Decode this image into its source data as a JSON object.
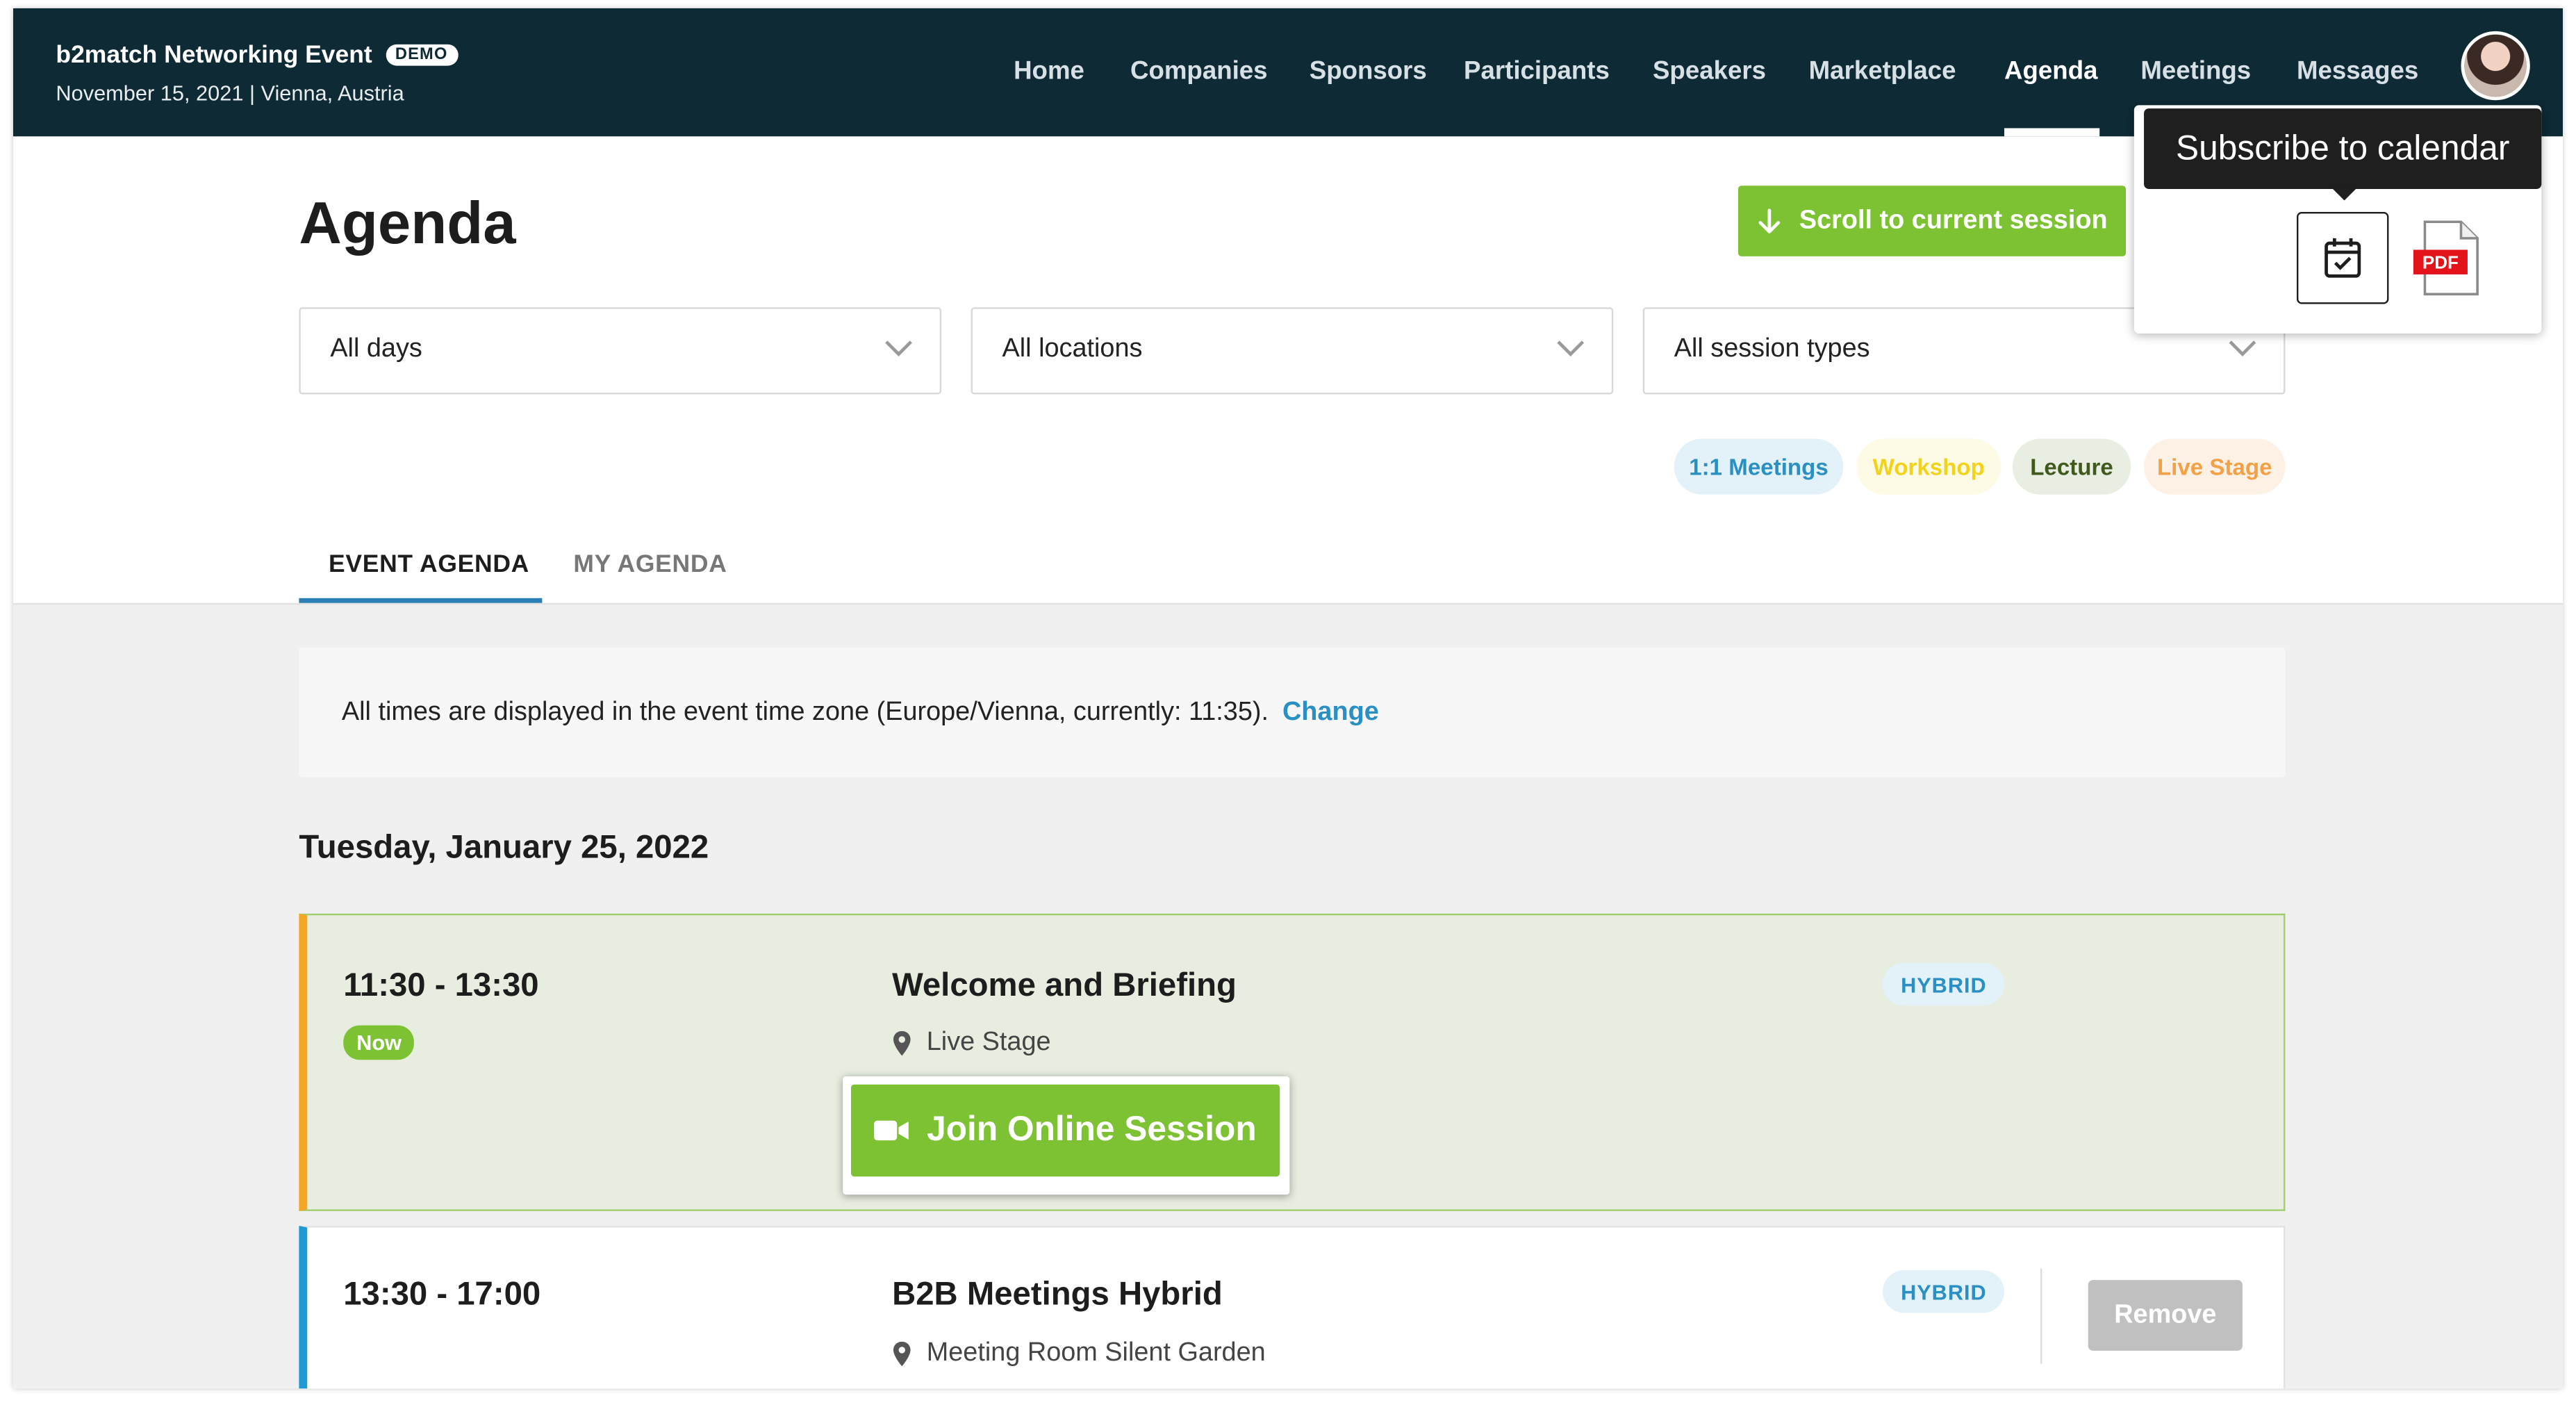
{
  "header": {
    "event_name": "b2match Networking Event",
    "demo_badge": "DEMO",
    "event_subtitle": "November 15, 2021 | Vienna, Austria",
    "nav": [
      "Home",
      "Companies",
      "Sponsors",
      "Participants",
      "Speakers",
      "Marketplace",
      "Agenda",
      "Meetings",
      "Messages"
    ],
    "active_nav": "Agenda"
  },
  "page": {
    "title": "Agenda",
    "scroll_button": "Scroll to current session"
  },
  "filters": {
    "days": "All days",
    "locations": "All locations",
    "session_types": "All session types"
  },
  "legend_tags": [
    {
      "label": "1:1 Meetings",
      "color": "#2a8fc3",
      "bg": "#e3f1f9"
    },
    {
      "label": "Workshop",
      "color": "#f2d21b",
      "bg": "#fdfbe6"
    },
    {
      "label": "Lecture",
      "color": "#3f5a1c",
      "bg": "#e9eee3"
    },
    {
      "label": "Live Stage",
      "color": "#f3a046",
      "bg": "#fdf1e6"
    }
  ],
  "tabs": {
    "event_agenda": "EVENT AGENDA",
    "my_agenda": "MY AGENDA"
  },
  "timezone": {
    "text": "All times are displayed in the event time zone (Europe/Vienna, currently: 11:35).",
    "change_link": "Change"
  },
  "agenda": {
    "date": "Tuesday, January 25, 2022",
    "sessions": [
      {
        "time": "11:30 - 13:30",
        "badge": "Now",
        "title": "Welcome and Briefing",
        "location": "Live Stage",
        "format": "HYBRID",
        "join_button": "Join Online Session",
        "accent": "#f5a623"
      },
      {
        "time": "13:30 - 17:00",
        "title": "B2B Meetings Hybrid",
        "location": "Meeting Room Silent Garden",
        "format": "HYBRID",
        "action_button": "Remove",
        "accent": "#1e9ad6"
      }
    ]
  },
  "calendar_popover": {
    "tooltip": "Subscribe to calendar",
    "pdf_label": "PDF",
    "icons": [
      "calendar-check-icon",
      "pdf-file-icon"
    ]
  },
  "colors": {
    "header_bg": "#0e2a35",
    "primary_green": "#7cc232",
    "link_blue": "#2a8fc3"
  }
}
